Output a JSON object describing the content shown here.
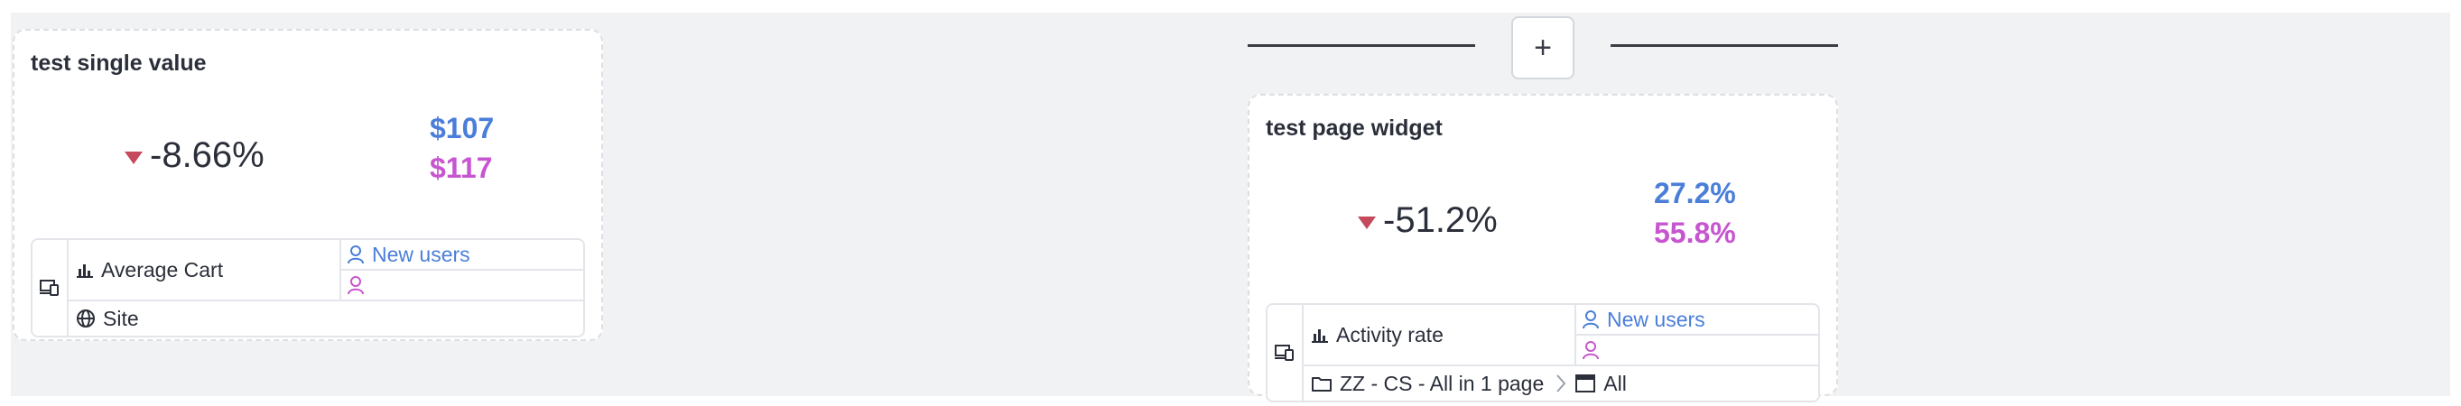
{
  "widgets": [
    {
      "title": "test single value",
      "change": "-8.66%",
      "current": "$107",
      "previous": "$117",
      "metric": "Average Cart",
      "segment_primary": "New users",
      "scope": "Site"
    },
    {
      "title": "test page widget",
      "change": "-51.2%",
      "current": "27.2%",
      "previous": "55.8%",
      "metric": "Activity rate",
      "segment_primary": "New users",
      "page_group": "ZZ - CS - All in 1 page",
      "page": "All"
    }
  ],
  "add_button": {
    "label": "+"
  },
  "colors": {
    "current": "#4a7ed9",
    "previous": "#c755cf",
    "decrease": "#c44a5c",
    "canvas": "#f1f2f4"
  },
  "icons": [
    "device-icon",
    "bar-chart-icon",
    "user-icon",
    "globe-icon",
    "folder-icon",
    "page-icon",
    "chevron-right-icon",
    "trend-down-icon"
  ]
}
